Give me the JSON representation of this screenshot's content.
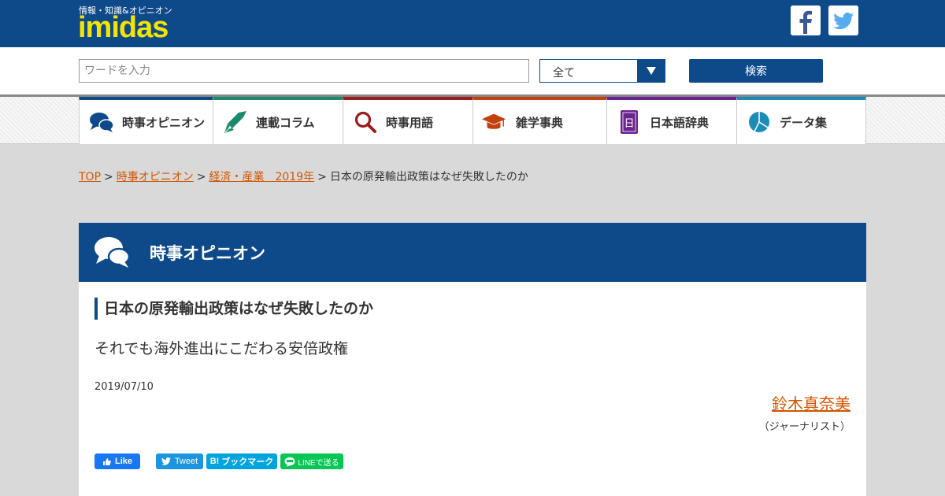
{
  "header": {
    "tagline": "情報・知識&オピニオン",
    "logo": "imidas",
    "social": [
      {
        "name": "facebook-icon"
      },
      {
        "name": "twitter-icon"
      }
    ]
  },
  "search": {
    "placeholder": "ワードを入力",
    "scope_value": "全て",
    "button_label": "検索"
  },
  "nav": {
    "items": [
      {
        "label": "時事オピニオン",
        "color": "#0e4a8a",
        "icon": "chat-bubbles-icon"
      },
      {
        "label": "連載コラム",
        "color": "#1a8a6a",
        "icon": "fountain-pen-icon"
      },
      {
        "label": "時事用語",
        "color": "#9b1c1c",
        "icon": "magnifier-icon"
      },
      {
        "label": "雑学事典",
        "color": "#c2410c",
        "icon": "mortarboard-icon"
      },
      {
        "label": "日本語辞典",
        "color": "#6b2391",
        "icon": "dictionary-book-icon"
      },
      {
        "label": "データ集",
        "color": "#1b8bb8",
        "icon": "pie-chart-icon"
      }
    ]
  },
  "breadcrumb": {
    "items": [
      "TOP",
      "時事オピニオン",
      "経済・産業　2019年"
    ],
    "current": "日本の原発輸出政策はなぜ失敗したのか",
    "separator": ">"
  },
  "section": {
    "title": "時事オピニオン"
  },
  "article": {
    "title": "日本の原発輸出政策はなぜ失敗したのか",
    "subtitle": "それでも海外進出にこだわる安倍政権",
    "date": "2019/07/10",
    "author": "鈴木真奈美",
    "author_role": "（ジャーナリスト）"
  },
  "share": {
    "facebook": "Like",
    "twitter": "Tweet",
    "hatena": "ブックマーク",
    "hatena_prefix": "B!",
    "line": "LINEで送る"
  },
  "colors": {
    "brand": "#0e4a8a",
    "logo": "#f5e400",
    "link": "#d45500"
  }
}
